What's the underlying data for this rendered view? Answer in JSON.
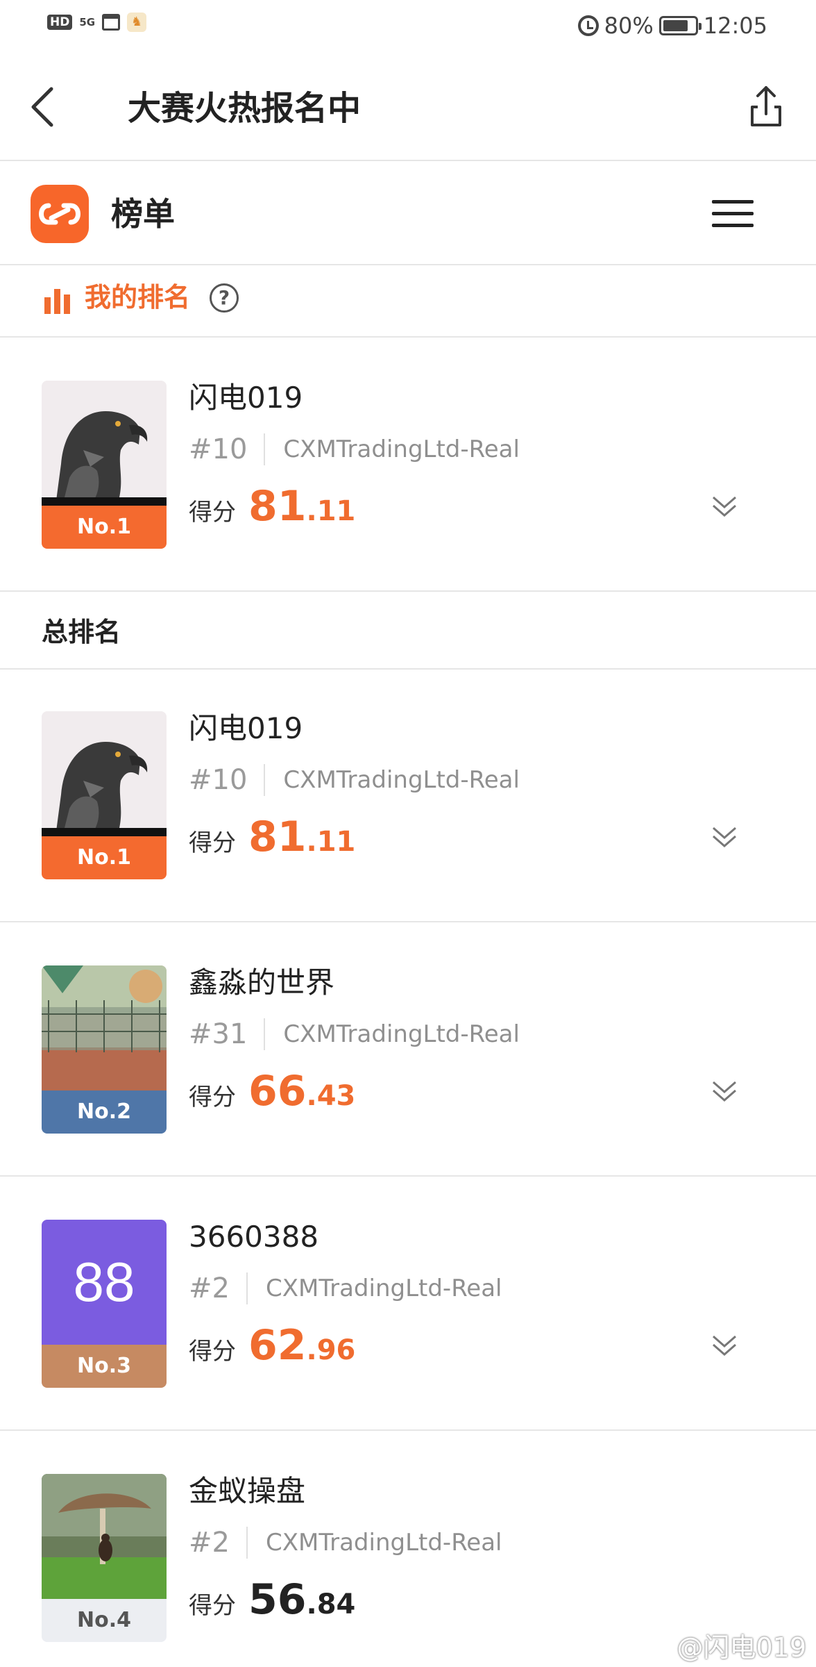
{
  "status_bar": {
    "hd": "HD",
    "signal": "5G",
    "app_icon": "app-notification-icon",
    "battery": "80%",
    "battery_level": 0.8,
    "time": "12:05"
  },
  "header": {
    "title": "大赛火热报名中",
    "back_icon": "back-arrow-icon",
    "share_icon": "share-icon"
  },
  "brand": {
    "title": "榜单",
    "logo_color": "#f7662a",
    "menu_icon": "hamburger-menu-icon"
  },
  "my_rank": {
    "label": "我的排名",
    "help": "?",
    "accent": "#f06c2f"
  },
  "my_entry": {
    "name": "闪电019",
    "num": "#10",
    "server": "CXMTradingLtd-Real",
    "score_label": "得分",
    "score_int": "81",
    "score_dec": ".11",
    "rank": "No.1",
    "avatar": "eagle",
    "badge_color": "#f46a2f",
    "score_color": "#f06c2f"
  },
  "overall": {
    "label": "总排名"
  },
  "entries": [
    {
      "name": "闪电019",
      "num": "#10",
      "server": "CXMTradingLtd-Real",
      "score_label": "得分",
      "score_int": "81",
      "score_dec": ".11",
      "rank": "No.1",
      "avatar": "eagle",
      "badge_color": "#f46a2f",
      "score_color": "#f06c2f"
    },
    {
      "name": "鑫淼的世界",
      "num": "#31",
      "server": "CXMTradingLtd-Real",
      "score_label": "得分",
      "score_int": "66",
      "score_dec": ".43",
      "rank": "No.2",
      "avatar": "court",
      "badge_color": "#4f76a8",
      "score_color": "#f06c2f"
    },
    {
      "name": "3660388",
      "num": "#2",
      "server": "CXMTradingLtd-Real",
      "score_label": "得分",
      "score_int": "62",
      "score_dec": ".96",
      "rank": "No.3",
      "avatar_text": "88",
      "avatar": "text",
      "badge_color": "#c68a62",
      "score_color": "#f06c2f"
    },
    {
      "name": "金蚁操盘",
      "num": "#2",
      "server": "CXMTradingLtd-Real",
      "score_label": "得分",
      "score_int": "56",
      "score_dec": ".84",
      "rank": "No.4",
      "avatar": "mushroom",
      "badge_color": "#eceef2",
      "score_color": "#222222"
    }
  ],
  "watermark": "@闪电019"
}
